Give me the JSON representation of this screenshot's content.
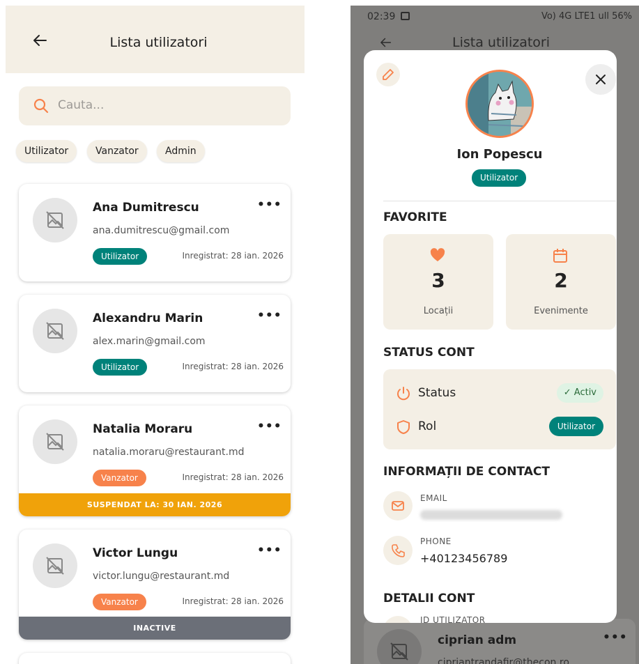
{
  "left": {
    "header": {
      "title": "Lista utilizatori"
    },
    "search": {
      "placeholder": "Cauta..."
    },
    "filters": [
      "Utilizator",
      "Vanzator",
      "Admin"
    ],
    "users": [
      {
        "name": "Ana Dumitrescu",
        "email": "ana.dumitrescu@gmail.com",
        "role": "Utilizator",
        "registered": "Inregistrat: 28 ian. 2026",
        "more": "•••"
      },
      {
        "name": "Alexandru Marin",
        "email": "alex.marin@gmail.com",
        "role": "Utilizator",
        "registered": "Inregistrat: 28 ian. 2026",
        "more": "•••"
      },
      {
        "name": "Natalia Moraru",
        "email": "natalia.moraru@restaurant.md",
        "role": "Vanzator",
        "registered": "Inregistrat: 28 ian. 2026",
        "more": "•••",
        "banner": "SUSPENDAT LA: 30 IAN. 2026"
      },
      {
        "name": "Victor Lungu",
        "email": "victor.lungu@restaurant.md",
        "role": "Vanzator",
        "registered": "Inregistrat: 28 ian. 2026",
        "more": "•••",
        "banner": "INACTIVE"
      }
    ]
  },
  "right": {
    "statusbar": {
      "time": "02:39",
      "right_icons": "Vo) 4G LTE1 ull 56%",
      "battery": "56%"
    },
    "header": {
      "title": "Lista utilizatori"
    },
    "background_card": {
      "name": "ciprian adm",
      "email": "cipriantrandafir@thecon.ro",
      "more": "•••"
    },
    "modal": {
      "name": "Ion Popescu",
      "role": "Utilizator",
      "favorites": {
        "title": "FAVORITE",
        "locations": {
          "count": "3",
          "label": "Locații"
        },
        "events": {
          "count": "2",
          "label": "Evenimente"
        }
      },
      "account_status": {
        "title": "STATUS CONT",
        "status_label": "Status",
        "status_value": "Activ",
        "role_label": "Rol",
        "role_value": "Utilizator"
      },
      "contact": {
        "title": "INFORMAȚII DE CONTACT",
        "email_label": "EMAIL",
        "phone_label": "PHONE",
        "phone_value": "+40123456789"
      },
      "details": {
        "title": "DETALII CONT",
        "id_label": "ID UTILIZATOR"
      }
    }
  },
  "colors": {
    "accent_orange": "#f7824b",
    "teal": "#00827a",
    "beige": "#f4efe5",
    "suspended": "#f0a20a",
    "inactive": "#6b6f78"
  }
}
